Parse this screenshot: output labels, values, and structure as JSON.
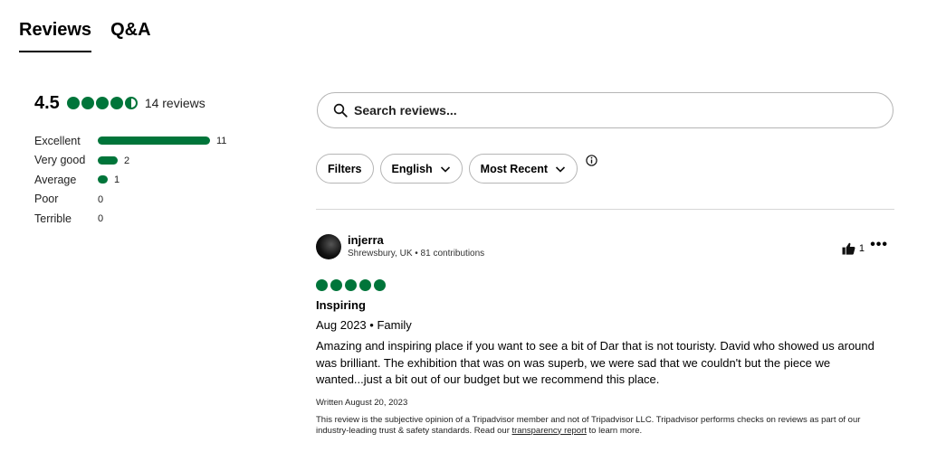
{
  "tabs": [
    {
      "label": "Reviews",
      "active": true
    },
    {
      "label": "Q&A",
      "active": false
    }
  ],
  "summary": {
    "score": "4.5",
    "bubble_rating": 4.5,
    "review_count": "14 reviews",
    "rows": [
      {
        "label": "Excellent",
        "count": "11",
        "fraction": 1.0
      },
      {
        "label": "Very good",
        "count": "2",
        "fraction": 0.18
      },
      {
        "label": "Average",
        "count": "1",
        "fraction": 0.09
      },
      {
        "label": "Poor",
        "count": "0",
        "fraction": 0
      },
      {
        "label": "Terrible",
        "count": "0",
        "fraction": 0
      }
    ]
  },
  "search": {
    "placeholder": "Search reviews..."
  },
  "filters": {
    "filters_label": "Filters",
    "language_label": "English",
    "sort_label": "Most Recent"
  },
  "review": {
    "author": "injerra",
    "meta": "Shrewsbury, UK • 81 contributions",
    "helpful_count": "1",
    "rating": 5,
    "title": "Inspiring",
    "date": "Aug 2023 • Family",
    "body": "Amazing and inspiring place if you want to see a bit of Dar that is not touristy. David who showed us around was brilliant. The exhibition that was on was superb, we were sad that we couldn't but the piece we wanted...just a bit out of our budget but we recommend this place.",
    "written": "Written August 20, 2023",
    "disclaimer_pre": "This review is the subjective opinion of a Tripadvisor member and not of Tripadvisor LLC. Tripadvisor performs checks on reviews as part of our industry-leading trust & safety standards. Read our ",
    "disclaimer_link": "transparency report",
    "disclaimer_post": " to learn more."
  },
  "colors": {
    "accent": "#00753a"
  },
  "icons": {
    "search": "search-icon",
    "chevron": "chevron-down-icon",
    "info": "info-icon",
    "thumb": "thumbs-up-icon",
    "more": "more-options-icon"
  }
}
